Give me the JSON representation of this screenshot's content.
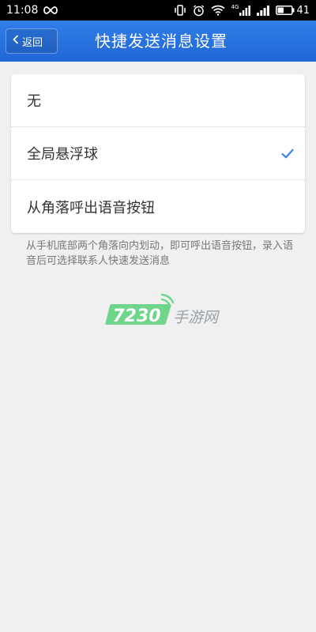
{
  "status_bar": {
    "time": "11:08",
    "network_label": "4G",
    "battery_level": "41"
  },
  "header": {
    "back_label": "返回",
    "title": "快捷发送消息设置"
  },
  "options": [
    {
      "label": "无",
      "selected": false
    },
    {
      "label": "全局悬浮球",
      "selected": true
    },
    {
      "label": "从角落呼出语音按钮",
      "selected": false
    }
  ],
  "description": "从手机底部两个角落向内划动，即可呼出语音按钮，录入语音后可选择联系人快速发送消息",
  "watermark": {
    "number": "7230",
    "text": "手游网"
  },
  "colors": {
    "header": "#2a74e2",
    "check": "#3b82e8",
    "watermark_green": "#6fd58a"
  }
}
